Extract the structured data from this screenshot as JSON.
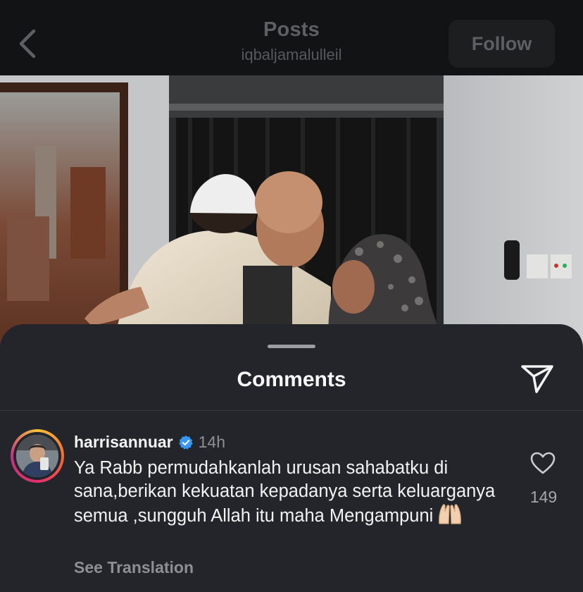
{
  "header": {
    "title": "Posts",
    "username": "iqbaljamalulleil",
    "follow_label": "Follow",
    "back_icon": "chevron-left-icon"
  },
  "comments_sheet": {
    "title": "Comments",
    "share_icon": "send-icon"
  },
  "comment": {
    "username": "harrisannuar",
    "verified": true,
    "time": "14h",
    "text": "Ya Rabb permudahkanlah urusan sahabatku di sana,berikan kekuatan kepadanya serta keluarganya semua ,sungguh Allah itu maha Mengampuni",
    "emoji": "🙌🏻",
    "see_translation": "See Translation",
    "likes": "149",
    "like_icon": "heart-outline-icon"
  },
  "colors": {
    "background": "#000000",
    "header": "#111315",
    "sheet": "#23252a",
    "verified_blue": "#3897f0"
  }
}
